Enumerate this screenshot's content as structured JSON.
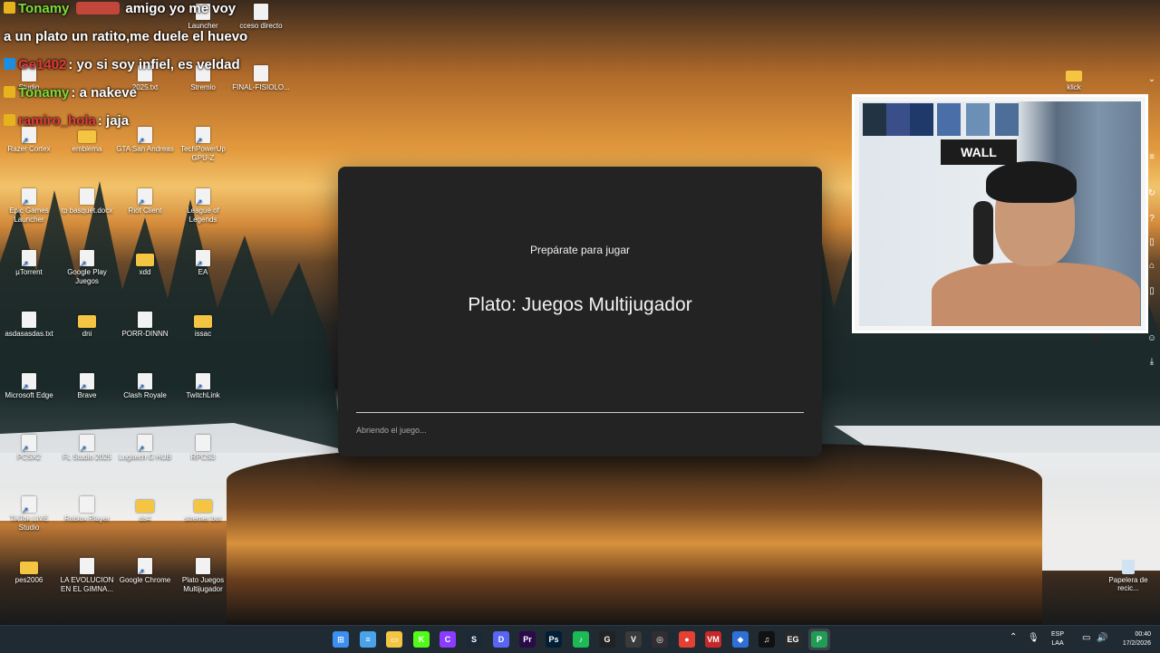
{
  "chat": {
    "messages": [
      {
        "user": "Tonamy",
        "user_color": "#7fdc3a",
        "text": "amigo yo me voy",
        "badge": "crown"
      },
      {
        "user": "",
        "user_color": "#ffffff",
        "text": "a un plato un ratito,me duele el huevo",
        "badge": ""
      },
      {
        "user": "Ge1402",
        "user_color": "#e53b3b",
        "text": ": yo si soy infiel, es veldad",
        "badge": "pin"
      },
      {
        "user": "Tonamy",
        "user_color": "#7fdc3a",
        "text": ": a nakeve",
        "badge": "crown"
      },
      {
        "user": "ramiro_hola",
        "user_color": "#e53b3b",
        "text": ": jaja",
        "badge": "crown"
      }
    ]
  },
  "desktop_icons": [
    {
      "label": "Launcher",
      "type": "file"
    },
    {
      "label": "cceso directo",
      "type": "file"
    },
    {
      "label": "Studio",
      "type": "file"
    },
    {
      "label": "2025.txt",
      "type": "file"
    },
    {
      "label": "Stremio",
      "type": "file"
    },
    {
      "label": "FINAL-FISIOLO...",
      "type": "file"
    },
    {
      "label": "Razer Cortex",
      "type": "shortcut"
    },
    {
      "label": "emblema",
      "type": "folder"
    },
    {
      "label": "GTA San Andreas",
      "type": "shortcut"
    },
    {
      "label": "TechPowerUp GPU-Z",
      "type": "shortcut"
    },
    {
      "label": "Epic Games Launcher",
      "type": "shortcut"
    },
    {
      "label": "tp basquet.docx",
      "type": "file"
    },
    {
      "label": "Riot Client",
      "type": "shortcut"
    },
    {
      "label": "League of Legends",
      "type": "shortcut"
    },
    {
      "label": "µTorrent",
      "type": "shortcut"
    },
    {
      "label": "Google Play Juegos",
      "type": "shortcut"
    },
    {
      "label": "xdd",
      "type": "folder"
    },
    {
      "label": "EA",
      "type": "shortcut"
    },
    {
      "label": "asdasasdas.txt",
      "type": "file"
    },
    {
      "label": "dni",
      "type": "folder"
    },
    {
      "label": "PORR-DINNN",
      "type": "file"
    },
    {
      "label": "issac",
      "type": "folder"
    },
    {
      "label": "Microsoft Edge",
      "type": "shortcut"
    },
    {
      "label": "Brave",
      "type": "shortcut"
    },
    {
      "label": "Clash Royale",
      "type": "shortcut"
    },
    {
      "label": "TwitchLink",
      "type": "shortcut"
    },
    {
      "label": "PCSX2",
      "type": "shortcut"
    },
    {
      "label": "FL Studio 2025",
      "type": "shortcut"
    },
    {
      "label": "Logitech G HUB",
      "type": "shortcut"
    },
    {
      "label": "RPCS3",
      "type": "file"
    },
    {
      "label": "TikTok LIVE Studio",
      "type": "shortcut"
    },
    {
      "label": "Roblox Player",
      "type": "file"
    },
    {
      "label": "ds4",
      "type": "folder"
    },
    {
      "label": "stremer bot",
      "type": "folder"
    },
    {
      "label": "pes2006",
      "type": "folder"
    },
    {
      "label": "LA EVOLUCION EN EL GIMNA...",
      "type": "file"
    },
    {
      "label": "Google Chrome",
      "type": "shortcut"
    },
    {
      "label": "Plato Juegos Multijugador",
      "type": "file"
    }
  ],
  "dialog": {
    "subtitle": "Prepárate para jugar",
    "title": "Plato: Juegos Multijugador",
    "status": "Abriendo el juego..."
  },
  "webcam": {
    "sign_text": "WALL"
  },
  "right_desktop": {
    "folder_label": "klick",
    "recycle_label": "Papelera de recic..."
  },
  "taskbar": {
    "apps": [
      {
        "name": "windows-start-icon",
        "color": "#3b8ff0",
        "glyph": "⊞"
      },
      {
        "name": "notepad-icon",
        "color": "#4aa3e8",
        "glyph": "≡"
      },
      {
        "name": "file-explorer-icon",
        "color": "#f4c542",
        "glyph": "▭"
      },
      {
        "name": "kick-icon",
        "color": "#53fc18",
        "glyph": "K"
      },
      {
        "name": "canva-icon",
        "color": "#8b3dff",
        "glyph": "C"
      },
      {
        "name": "steam-icon",
        "color": "#1b2838",
        "glyph": "S"
      },
      {
        "name": "discord-icon",
        "color": "#5865f2",
        "glyph": "D"
      },
      {
        "name": "premiere-icon",
        "color": "#2a0a4a",
        "glyph": "Pr"
      },
      {
        "name": "photoshop-icon",
        "color": "#001e36",
        "glyph": "Ps"
      },
      {
        "name": "spotify-icon",
        "color": "#1db954",
        "glyph": "♪"
      },
      {
        "name": "logitech-icon",
        "color": "#222222",
        "glyph": "G"
      },
      {
        "name": "valorant-icon",
        "color": "#3a3a3a",
        "glyph": "V"
      },
      {
        "name": "obs-icon",
        "color": "#302e31",
        "glyph": "◎"
      },
      {
        "name": "chrome-icon",
        "color": "#e44134",
        "glyph": "●"
      },
      {
        "name": "voicemeeter-icon",
        "color": "#c62828",
        "glyph": "VM"
      },
      {
        "name": "streamerbot-icon",
        "color": "#2f6fd8",
        "glyph": "◆"
      },
      {
        "name": "tiktok-icon",
        "color": "#111111",
        "glyph": "♫"
      },
      {
        "name": "epic-games-icon",
        "color": "#2a2a2a",
        "glyph": "EG"
      },
      {
        "name": "plato-icon",
        "color": "#1f9d55",
        "glyph": "P"
      }
    ],
    "lang_line1": "ESP",
    "lang_line2": "LAA",
    "time": "00:40",
    "date": "17/2/2026"
  }
}
